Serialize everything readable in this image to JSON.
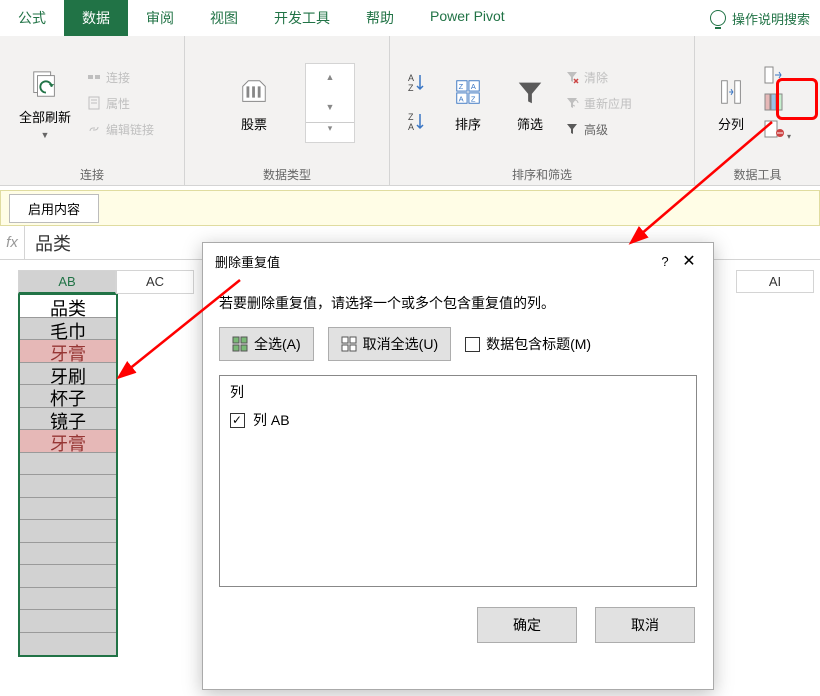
{
  "tabs": {
    "items": [
      "公式",
      "数据",
      "审阅",
      "视图",
      "开发工具",
      "帮助",
      "Power Pivot"
    ],
    "active_index": 1,
    "search": "操作说明搜索"
  },
  "ribbon": {
    "group1": {
      "refresh": "全部刷新",
      "conn": "连接",
      "props": "属性",
      "editlinks": "编辑链接",
      "label": "连接"
    },
    "group2": {
      "stock": "股票",
      "label": "数据类型"
    },
    "group3": {
      "sort": "排序",
      "filter": "筛选",
      "clear": "清除",
      "reapply": "重新应用",
      "adv": "高级",
      "label": "排序和筛选"
    },
    "group4": {
      "texttocols": "分列",
      "label": "数据工具"
    }
  },
  "msgbar": {
    "enable": "启用内容"
  },
  "formula": {
    "value": "品类"
  },
  "sheet": {
    "col_ab": "AB",
    "col_ac": "AC",
    "col_ai": "AI",
    "rows": [
      "品类",
      "毛巾",
      "牙膏",
      "牙刷",
      "杯子",
      "镜子",
      "牙膏"
    ]
  },
  "dialog": {
    "title": "删除重复值",
    "help": "?",
    "desc": "若要删除重复值，请选择一个或多个包含重复值的列。",
    "select_all": "全选(A)",
    "deselect_all": "取消全选(U)",
    "has_header": "数据包含标题(M)",
    "col_header": "列",
    "col_item": "列 AB",
    "ok": "确定",
    "cancel": "取消"
  }
}
